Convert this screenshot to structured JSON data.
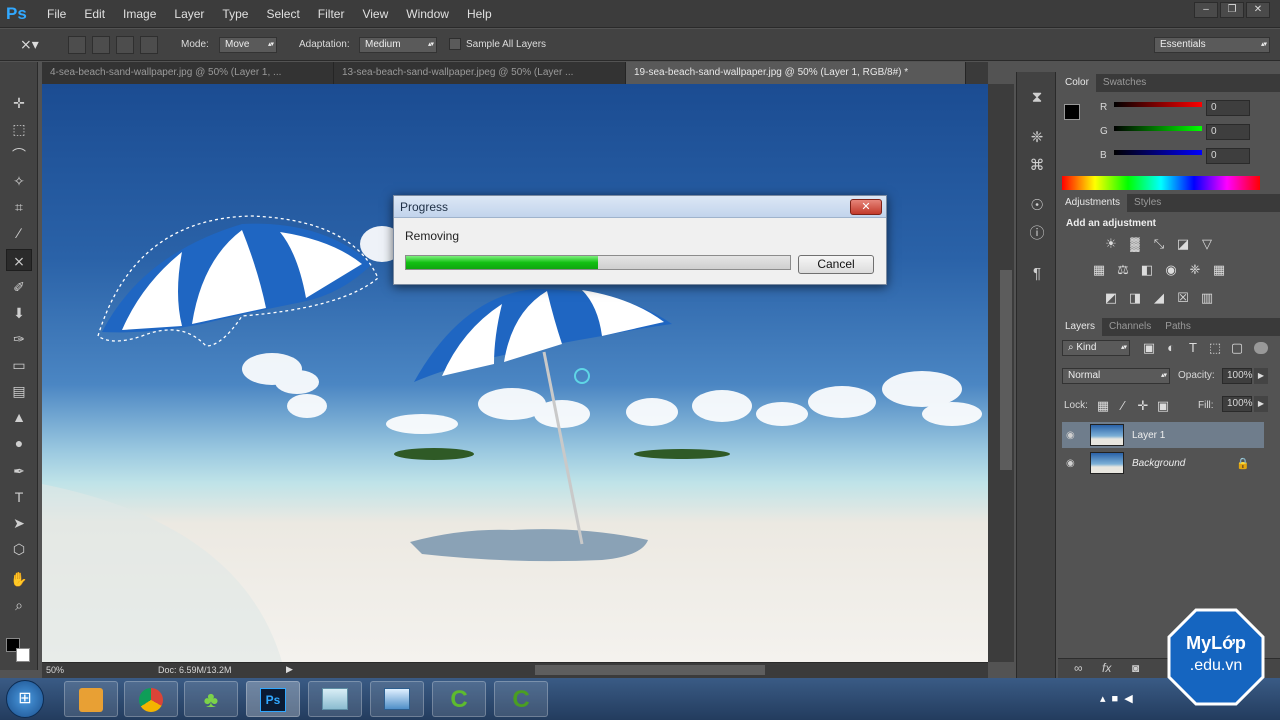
{
  "app": {
    "logo": "Ps"
  },
  "menu": [
    "File",
    "Edit",
    "Image",
    "Layer",
    "Type",
    "Select",
    "Filter",
    "View",
    "Window",
    "Help"
  ],
  "options_bar": {
    "mode_label": "Mode:",
    "mode_value": "Move",
    "adaptation_label": "Adaptation:",
    "adaptation_value": "Medium",
    "sample_all_layers": "Sample All Layers",
    "workspace": "Essentials"
  },
  "document_tabs": [
    {
      "label": "4-sea-beach-sand-wallpaper.jpg @ 50% (Layer 1, ...",
      "active": false
    },
    {
      "label": "13-sea-beach-sand-wallpaper.jpeg @ 50% (Layer ...",
      "active": false
    },
    {
      "label": "19-sea-beach-sand-wallpaper.jpg @ 50% (Layer 1, RGB/8#) *",
      "active": true
    }
  ],
  "status_bar": {
    "zoom": "50%",
    "doc": "Doc: 6.59M/13.2M"
  },
  "color_panel": {
    "tabs": [
      "Color",
      "Swatches"
    ],
    "channels": [
      {
        "label": "R",
        "value": "0",
        "color": "#cc2222"
      },
      {
        "label": "G",
        "value": "0",
        "color": "#22bb22"
      },
      {
        "label": "B",
        "value": "0",
        "color": "#2233cc"
      }
    ]
  },
  "adjustments_panel": {
    "tabs": [
      "Adjustments",
      "Styles"
    ],
    "heading": "Add an adjustment"
  },
  "layers_panel": {
    "tabs": [
      "Layers",
      "Channels",
      "Paths"
    ],
    "filter": "Kind",
    "blend_mode": "Normal",
    "opacity_label": "Opacity:",
    "opacity_value": "100%",
    "lock_label": "Lock:",
    "fill_label": "Fill:",
    "fill_value": "100%",
    "layers": [
      {
        "name": "Layer 1",
        "selected": true
      },
      {
        "name": "Background",
        "selected": false
      }
    ]
  },
  "progress_dialog": {
    "title": "Progress",
    "message": "Removing",
    "progress": 0.5,
    "cancel_label": "Cancel"
  },
  "watermark": {
    "line1": "MyLớp",
    "line2": ".edu.vn"
  },
  "colors": {
    "ps_blue": "#31a8ff",
    "progress_green": "#12c012",
    "badge_blue": "#1565c0"
  }
}
